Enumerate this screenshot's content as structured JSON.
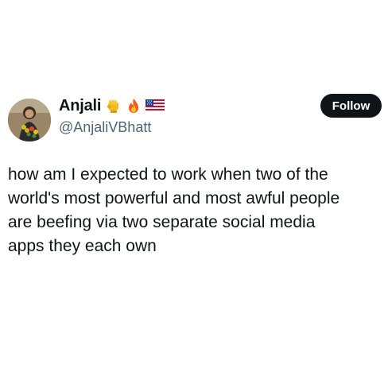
{
  "user": {
    "display_name": "Anjali",
    "badges": [
      "raised-fist-icon",
      "fire-icon",
      "us-flag-icon"
    ],
    "handle": "@AnjaliVBhatt"
  },
  "actions": {
    "follow_label": "Follow"
  },
  "tweet": {
    "text": "how am I expected to work when two of the\nworld's most powerful and most awful people\nare beefing via two separate social media\napps they each own"
  },
  "colors": {
    "text_primary": "#0f1419",
    "text_secondary": "#536471",
    "button_bg": "#0f1419",
    "button_text": "#ffffff"
  }
}
